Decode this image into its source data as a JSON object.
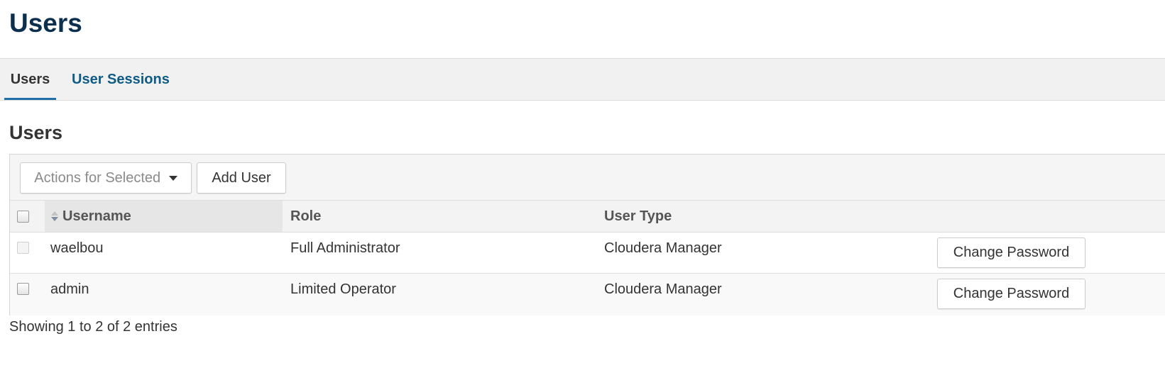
{
  "page": {
    "title": "Users"
  },
  "tabs": [
    {
      "label": "Users",
      "active": true
    },
    {
      "label": "User Sessions",
      "active": false
    }
  ],
  "section": {
    "title": "Users"
  },
  "toolbar": {
    "actions_label": "Actions for Selected",
    "add_user_label": "Add User"
  },
  "table": {
    "columns": [
      "Username",
      "Role",
      "User Type"
    ],
    "rows": [
      {
        "username": "waelbou",
        "role": "Full Administrator",
        "user_type": "Cloudera Manager",
        "action_label": "Change Password",
        "checkbox_disabled": true
      },
      {
        "username": "admin",
        "role": "Limited Operator",
        "user_type": "Cloudera Manager",
        "action_label": "Change Password",
        "checkbox_disabled": false
      }
    ],
    "info": "Showing 1 to 2 of 2 entries"
  },
  "colors": {
    "title": "#0b2f4c",
    "link": "#0f5b86",
    "active_tab_underline": "#1d6fa5"
  },
  "icons": {
    "sort": "sort-both-icon",
    "caret": "caret-down-icon"
  }
}
